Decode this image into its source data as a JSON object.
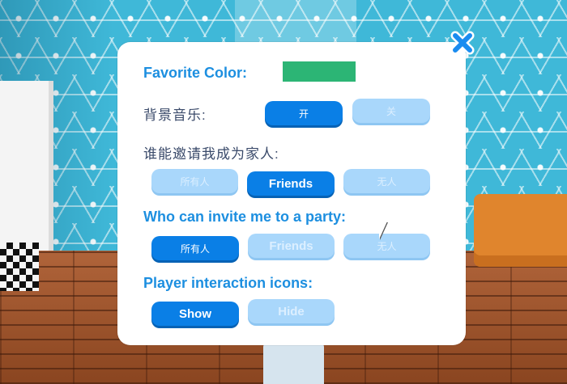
{
  "settings": {
    "favorite_color": {
      "label": "Favorite Color:",
      "value_color": "#2cb575"
    },
    "background_music": {
      "label": "背景音乐:",
      "options": [
        "开",
        "关"
      ],
      "selected": "开"
    },
    "family_invite": {
      "label": "谁能邀请我成为家人:",
      "options": [
        "所有人",
        "Friends",
        "无人"
      ],
      "selected": "Friends"
    },
    "party_invite": {
      "label": "Who can invite me to a party:",
      "options": [
        "所有人",
        "Friends",
        "无人"
      ],
      "selected": "所有人"
    },
    "interaction_icons": {
      "label": "Player interaction icons:",
      "options": [
        "Show",
        "Hide"
      ],
      "selected": "Show"
    }
  },
  "icons": {
    "close": "close-icon"
  },
  "colors": {
    "accent": "#0a7fe6",
    "accent_inactive": "#a9d7fb",
    "label_blue": "#1d8fe0",
    "close_blue": "#1a8cf0"
  }
}
